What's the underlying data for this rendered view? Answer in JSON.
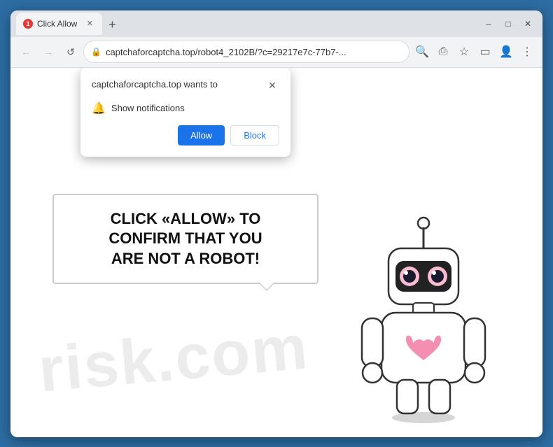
{
  "window": {
    "controls": {
      "minimize": "–",
      "maximize": "□",
      "close": "✕"
    }
  },
  "tab": {
    "favicon_label": "1",
    "title": "Click Allow",
    "close_label": "✕"
  },
  "new_tab_button": "+",
  "toolbar": {
    "back_label": "←",
    "forward_label": "→",
    "refresh_label": "↺",
    "url": "captchaforcaptcha.top/robot4_2102B/?c=29217e7c-77b7-...",
    "search_icon": "🔍",
    "share_icon": "⎙",
    "bookmark_icon": "☆",
    "sidebar_icon": "▭",
    "profile_icon": "👤",
    "menu_icon": "⋮"
  },
  "notification_popup": {
    "title": "captchaforcaptcha.top wants to",
    "close_label": "✕",
    "notification_text": "Show notifications",
    "allow_label": "Allow",
    "block_label": "Block"
  },
  "page": {
    "main_heading_line1": "CLICK «ALLOW» TO CONFIRM THAT YOU",
    "main_heading_line2": "ARE NOT A ROBOT!",
    "watermark": "risk.com"
  }
}
